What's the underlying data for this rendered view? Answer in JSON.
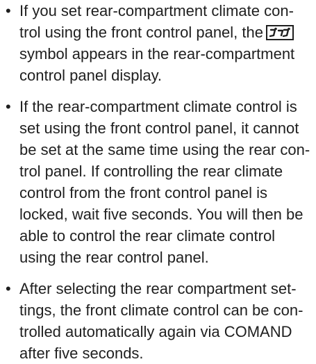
{
  "bullets": [
    {
      "lines": [
        "If you set rear-compartment climate con-",
        "trol using the front control panel, the",
        "symbol appears in the rear-compartment",
        "control panel display."
      ],
      "icon": "rear-climate-sync-icon"
    },
    {
      "lines": [
        "If the rear-compartment climate control is",
        "set using the front control panel, it cannot",
        "be set at the same time using the rear con-",
        "trol panel. If controlling the rear climate",
        "control from the front control panel is",
        "locked, wait five seconds. You will then be",
        "able to control the rear climate control",
        "using the rear control panel."
      ]
    },
    {
      "lines": [
        "After selecting the rear compartment set-",
        "tings, the front climate control can be con-",
        "trolled automatically again via COMAND",
        "after five seconds."
      ]
    }
  ]
}
